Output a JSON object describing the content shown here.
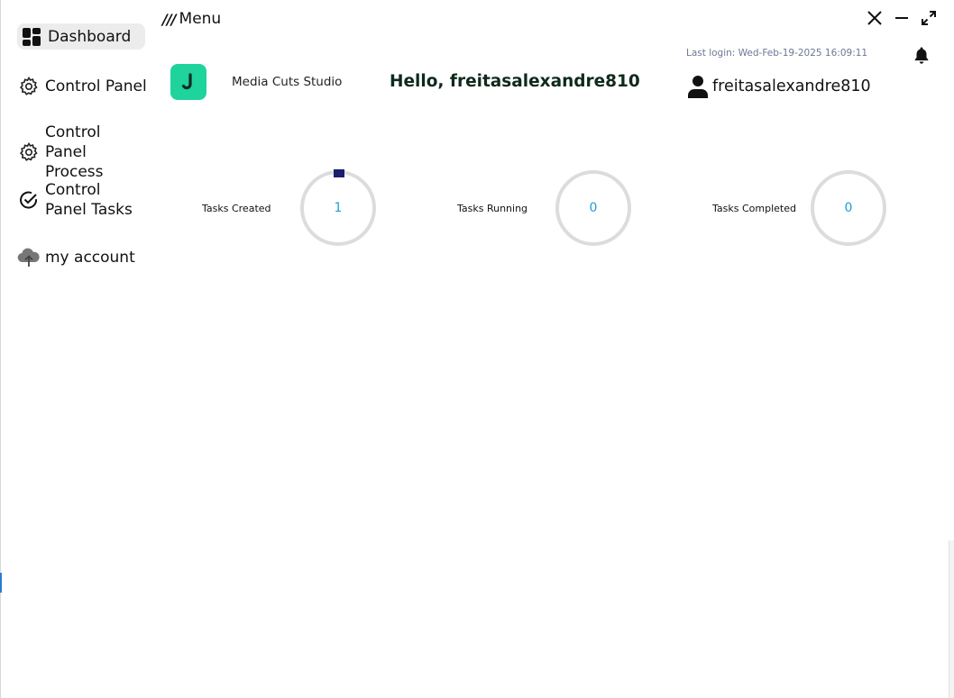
{
  "sidebar": {
    "items": [
      {
        "label": "Dashboard",
        "icon": "dashboard-icon",
        "active": true
      },
      {
        "label": "Control Panel",
        "icon": "gear-icon"
      },
      {
        "label": "Control Panel Process",
        "icon": "gear-icon"
      },
      {
        "label": "Control Panel Tasks",
        "icon": "check-circle-icon"
      },
      {
        "label": "my account",
        "icon": "cloud-upload-icon"
      }
    ]
  },
  "header": {
    "menu_glyph": "///",
    "menu_label": "Menu",
    "last_login": "Last login: Wed-Feb-19-2025  16:09:11",
    "studio_name": "Media Cuts Studio",
    "logo_letter": "J",
    "greeting": "Hello, freitasalexandre810",
    "username": "freitasalexandre810"
  },
  "window_controls": [
    "close-icon",
    "minimize-icon",
    "expand-icon"
  ],
  "stats": [
    {
      "label": "Tasks Created",
      "value": "1",
      "progress_marker": true
    },
    {
      "label": "Tasks Running",
      "value": "0",
      "progress_marker": false
    },
    {
      "label": "Tasks Completed",
      "value": "0",
      "progress_marker": false
    }
  ],
  "colors": {
    "logo_bg": "#1fd39c",
    "ring_track": "#dcdcdc",
    "ring_marker": "#1b1f6e",
    "value_text": "#1f9ed6",
    "greeting_text": "#0f2a1c",
    "last_login_text": "#6b7896",
    "active_nav_bg": "#ececec"
  }
}
